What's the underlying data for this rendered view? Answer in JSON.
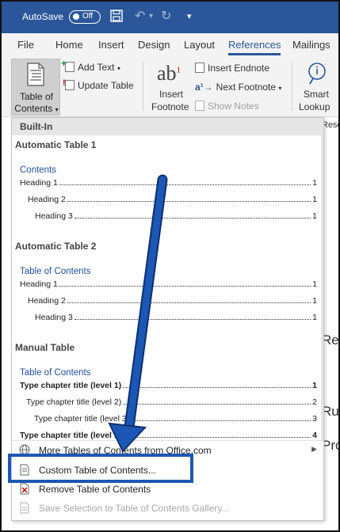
{
  "titlebar": {
    "autosave_label": "AutoSave",
    "toggle_state": "Off"
  },
  "tabs": [
    "File",
    "Home",
    "Insert",
    "Design",
    "Layout",
    "References",
    "Mailings"
  ],
  "active_tab": "References",
  "ribbon": {
    "toc_line1": "Table of",
    "toc_line2": "Contents",
    "add_text": "Add Text",
    "update_table": "Update Table",
    "insert_footnote_1": "Insert",
    "insert_footnote_2": "Footnote",
    "insert_endnote": "Insert Endnote",
    "next_footnote": "Next Footnote",
    "show_notes": "Show Notes",
    "smart_lookup_1": "Smart",
    "smart_lookup_2": "Lookup",
    "rese_cut": "Rese"
  },
  "dropdown": {
    "header": "Built-In",
    "sections": [
      {
        "name": "Automatic Table 1",
        "title": "Contents",
        "entries": [
          {
            "text": "Heading 1",
            "page": "1"
          },
          {
            "text": "Heading 2",
            "page": "1"
          },
          {
            "text": "Heading 3",
            "page": "1"
          }
        ]
      },
      {
        "name": "Automatic Table 2",
        "title": "Table of Contents",
        "entries": [
          {
            "text": "Heading 1",
            "page": "1"
          },
          {
            "text": "Heading 2",
            "page": "1"
          },
          {
            "text": "Heading 3",
            "page": "1"
          }
        ]
      },
      {
        "name": "Manual Table",
        "title": "Table of Contents",
        "entries": [
          {
            "text": "Type chapter title (level 1)",
            "page": "1"
          },
          {
            "text": "Type chapter title (level 2)",
            "page": "2"
          },
          {
            "text": "Type chapter title (level 3)",
            "page": "3"
          },
          {
            "text": "Type chapter title (level 1)",
            "page": "4"
          }
        ]
      }
    ],
    "menu": [
      {
        "label": "More Tables of Contents from Office.com",
        "icon": "globe-icon",
        "disabled": false,
        "submenu": true
      },
      {
        "label": "Custom Table of Contents...",
        "icon": "custom-toc-icon",
        "disabled": false,
        "submenu": false
      },
      {
        "label": "Remove Table of Contents",
        "icon": "remove-toc-icon",
        "disabled": false,
        "submenu": false
      },
      {
        "label": "Save Selection to Table of Contents Gallery...",
        "icon": "save-gallery-icon",
        "disabled": true,
        "submenu": false
      }
    ]
  },
  "doc_peek": [
    "Rea",
    "Ru",
    "Pro"
  ],
  "colors": {
    "titlebar": "#2b579a",
    "accent": "#2b579a",
    "highlight_box": "#1c57b5",
    "arrow": "#1c57b5"
  }
}
